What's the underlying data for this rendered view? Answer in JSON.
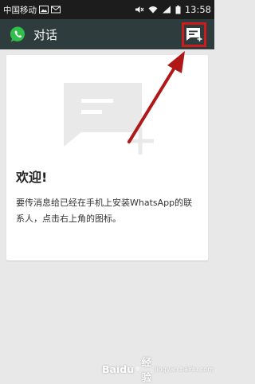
{
  "status_bar": {
    "carrier": "中国移动",
    "time": "13:58",
    "icons": [
      "image-icon",
      "mail-icon",
      "mute-icon",
      "wifi-icon",
      "signal-icon",
      "battery-icon"
    ]
  },
  "header": {
    "title": "对话",
    "new_chat_icon": "new-chat-icon"
  },
  "empty_state": {
    "heading": "欢迎!",
    "description": "要传消息给已经在手机上安装WhatsApp的联系人，点击右上角的图标。"
  },
  "watermark": {
    "brand": "Baidu",
    "product": "经验",
    "domain": "jingyan.baidu.com"
  },
  "colors": {
    "action_bar": "#2f3c3e",
    "highlight": "#cc1c1c",
    "background": "#e8e8e8"
  }
}
